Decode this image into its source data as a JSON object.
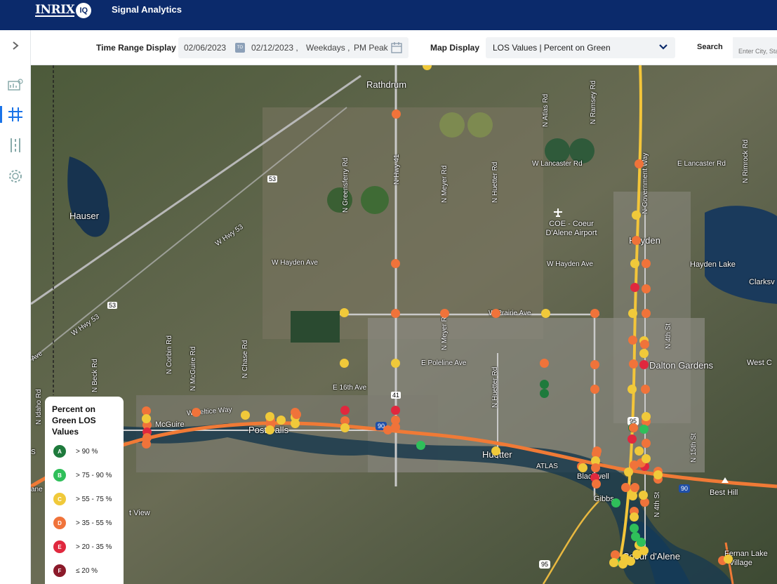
{
  "app": {
    "logo_text": "INRIX",
    "logo_badge": "IQ",
    "name": "Signal Analytics"
  },
  "toolbar": {
    "time_range_label": "Time Range Display",
    "start_date": "02/06/2023",
    "to_badge": "TO",
    "end_date": "02/12/2023 ,",
    "days": "Weekdays ,",
    "period": "PM Peak",
    "map_display_label": "Map Display",
    "map_display_value": "LOS Values | Percent on Green",
    "search_label": "Search",
    "search_placeholder": "Enter City, State"
  },
  "legend": {
    "title": "Percent on Green LOS Values",
    "items": [
      {
        "grade": "A",
        "label": "> 90 %",
        "color": "#1e7a3c"
      },
      {
        "grade": "B",
        "label": "> 75 - 90 %",
        "color": "#2fbf5a"
      },
      {
        "grade": "C",
        "label": "> 55 - 75 %",
        "color": "#f0c93a"
      },
      {
        "grade": "D",
        "label": "> 35 - 55 %",
        "color": "#f0733a"
      },
      {
        "grade": "E",
        "label": "> 20 - 35 %",
        "color": "#e0283e"
      },
      {
        "grade": "F",
        "label": "≤ 20 %",
        "color": "#8b1a2a"
      }
    ]
  },
  "map_labels": {
    "rathdrum": "Rathdrum",
    "hauser": "Hauser",
    "hayden": "Hayden",
    "hayden_lake": "Hayden Lake",
    "clarksville": "Clarksv",
    "dalton": "Dalton Gardens",
    "westc": "West C",
    "mcguire": "McGuire",
    "postfalls": "Post Falls",
    "huetter": "Huetter",
    "blackwell": "Blackwell",
    "gibbs": "Gibbs",
    "bestHill": "Best Hill",
    "cda": "Coeur d'Alene",
    "fernan": "Fernan Lake",
    "village": "Village",
    "airport": "COE - Coeur D'Alene Airport",
    "atlas": "ATLAS",
    "lancaster_w": "W Lancaster Rd",
    "lancaster_e": "E Lancaster Rd",
    "hayden_ave": "W Hayden Ave",
    "hayden_ave2": "W Hayden Ave",
    "prairie": "W Prairie Ave",
    "poleline": "E Poleline Ave",
    "sixteenth": "E 16th Ave",
    "hwy53": "W Hwy 53",
    "hwy53b": "W Hwy 53",
    "ave": "Ave",
    "view": "t View",
    "lane": "ane",
    "seltice": "W Seltice Way",
    "s_label": "S",
    "nhwy41": "N Hwy 41",
    "greensferry": "N Greensferry Rd",
    "meyer": "N Meyer Rd",
    "meyer2": "N Meyer Rd",
    "huetter_rd": "N Huetter Rd",
    "huetter_rd2": "N Huetter Rd",
    "atlas_rd": "N Atlas Rd",
    "ramsey": "N Ramsey Rd",
    "govway": "N Government Way",
    "rimrock": "N Rimrock Rd",
    "fourth": "N 4th St",
    "fourth2": "N 4th St",
    "fifteenth": "N 15th St",
    "idaho": "N Idaho Rd",
    "beck": "N Beck Rd",
    "corbin": "N Corbin Rd",
    "mcguire_rd": "N McGuire Rd",
    "chase": "N Chase Rd",
    "shield_53a": "53",
    "shield_53b": "53",
    "shield_41": "41",
    "shield_90a": "90",
    "shield_90b": "90",
    "shield_95a": "95",
    "shield_95b": "95"
  },
  "signals": [
    {
      "grade": "C"
    },
    {
      "grade": "D"
    },
    {
      "grade": "D"
    },
    {
      "grade": "C"
    },
    {
      "grade": "D"
    },
    {
      "grade": "C"
    },
    {
      "grade": "D"
    },
    {
      "grade": "D"
    },
    {
      "grade": "E"
    },
    {
      "grade": "D"
    },
    {
      "grade": "C"
    },
    {
      "grade": "D"
    },
    {
      "grade": "D"
    },
    {
      "grade": "D"
    },
    {
      "grade": "C"
    },
    {
      "grade": "D"
    },
    {
      "grade": "C"
    },
    {
      "grade": "D"
    },
    {
      "grade": "C"
    },
    {
      "grade": "C"
    },
    {
      "grade": "D"
    },
    {
      "grade": "D"
    },
    {
      "grade": "D"
    },
    {
      "grade": "E"
    },
    {
      "grade": "C"
    },
    {
      "grade": "C"
    },
    {
      "grade": "D"
    },
    {
      "grade": "D"
    },
    {
      "grade": "A"
    },
    {
      "grade": "A"
    },
    {
      "grade": "D"
    },
    {
      "grade": "C"
    },
    {
      "grade": "D"
    },
    {
      "grade": "E"
    },
    {
      "grade": "E"
    },
    {
      "grade": "D"
    },
    {
      "grade": "B"
    },
    {
      "grade": "C"
    },
    {
      "grade": "D"
    },
    {
      "grade": "C"
    },
    {
      "grade": "C"
    },
    {
      "grade": "D"
    },
    {
      "grade": "D"
    },
    {
      "grade": "C"
    },
    {
      "grade": "D"
    },
    {
      "grade": "C"
    },
    {
      "grade": "D"
    },
    {
      "grade": "E"
    },
    {
      "grade": "D"
    },
    {
      "grade": "E"
    },
    {
      "grade": "D"
    },
    {
      "grade": "D"
    },
    {
      "grade": "A"
    },
    {
      "grade": "B"
    },
    {
      "grade": "C"
    },
    {
      "grade": "B"
    },
    {
      "grade": "B"
    },
    {
      "grade": "C"
    },
    {
      "grade": "C"
    },
    {
      "grade": "D"
    },
    {
      "grade": "C"
    },
    {
      "grade": "D"
    },
    {
      "grade": "D"
    },
    {
      "grade": "C"
    },
    {
      "grade": "D"
    },
    {
      "grade": "D"
    },
    {
      "grade": "B"
    },
    {
      "grade": "C"
    },
    {
      "grade": "C"
    },
    {
      "grade": "D"
    },
    {
      "grade": "E"
    },
    {
      "grade": "D"
    },
    {
      "grade": "D"
    },
    {
      "grade": "C"
    },
    {
      "grade": "D"
    },
    {
      "grade": "D"
    },
    {
      "grade": "C"
    },
    {
      "grade": "D"
    },
    {
      "grade": "C"
    },
    {
      "grade": "D"
    },
    {
      "grade": "D"
    },
    {
      "grade": "D"
    },
    {
      "grade": "C"
    },
    {
      "grade": "D"
    },
    {
      "grade": "C"
    },
    {
      "grade": "D"
    },
    {
      "grade": "D"
    },
    {
      "grade": "C"
    },
    {
      "grade": "C"
    },
    {
      "grade": "D"
    },
    {
      "grade": "D"
    },
    {
      "grade": "E"
    },
    {
      "grade": "C"
    },
    {
      "grade": "D"
    },
    {
      "grade": "C"
    },
    {
      "grade": "B"
    },
    {
      "grade": "C"
    },
    {
      "grade": "C"
    },
    {
      "grade": "C"
    },
    {
      "grade": "D"
    },
    {
      "grade": "D"
    },
    {
      "grade": "C"
    },
    {
      "grade": "B"
    },
    {
      "grade": "C"
    },
    {
      "grade": "C"
    },
    {
      "grade": "C"
    }
  ]
}
